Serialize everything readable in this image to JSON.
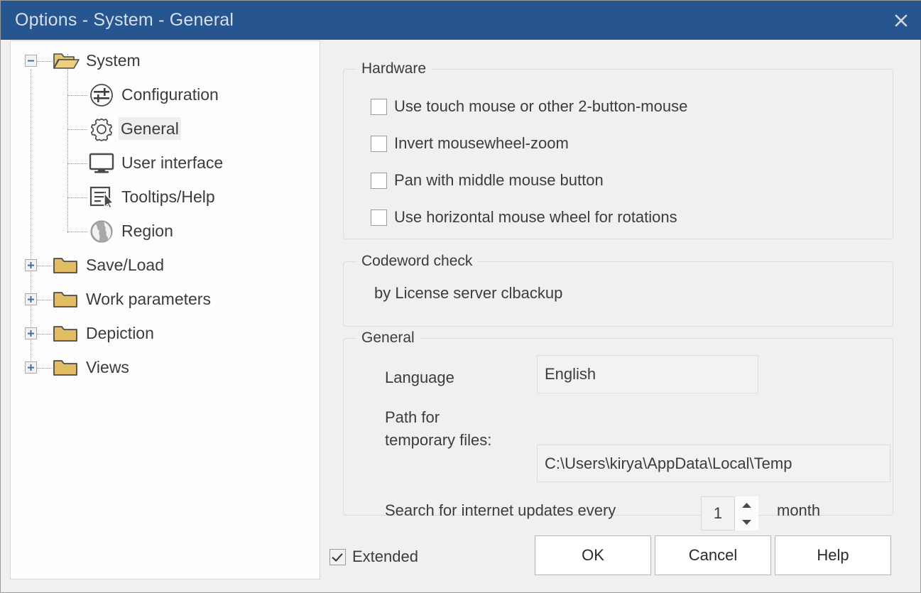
{
  "window": {
    "title": "Options - System - General",
    "close_icon": "close-icon"
  },
  "tree": {
    "nodes": [
      {
        "label": "System",
        "icon": "open-folder-icon",
        "expander": "minus",
        "level": 0,
        "selected": false
      },
      {
        "label": "Configuration",
        "icon": "sliders-circle-icon",
        "expander": "none",
        "level": 1,
        "selected": false
      },
      {
        "label": "General",
        "icon": "gear-icon",
        "expander": "none",
        "level": 1,
        "selected": true
      },
      {
        "label": "User interface",
        "icon": "monitor-icon",
        "expander": "none",
        "level": 1,
        "selected": false
      },
      {
        "label": "Tooltips/Help",
        "icon": "tooltip-cursor-icon",
        "expander": "none",
        "level": 1,
        "selected": false
      },
      {
        "label": "Region",
        "icon": "globe-icon",
        "expander": "none",
        "level": 1,
        "selected": false
      },
      {
        "label": "Save/Load",
        "icon": "folder-icon",
        "expander": "plus",
        "level": 0,
        "selected": false
      },
      {
        "label": "Work parameters",
        "icon": "folder-icon",
        "expander": "plus",
        "level": 0,
        "selected": false
      },
      {
        "label": "Depiction",
        "icon": "folder-icon",
        "expander": "plus",
        "level": 0,
        "selected": false
      },
      {
        "label": "Views",
        "icon": "folder-icon",
        "expander": "plus",
        "level": 0,
        "selected": false
      }
    ]
  },
  "hardware": {
    "title": "Hardware",
    "checkboxes": [
      {
        "label": "Use touch mouse or other 2-button-mouse",
        "checked": false
      },
      {
        "label": "Invert mousewheel-zoom",
        "checked": false
      },
      {
        "label": "Pan with middle mouse button",
        "checked": false
      },
      {
        "label": "Use horizontal mouse wheel for rotations",
        "checked": false
      }
    ]
  },
  "codeword": {
    "title": "Codeword check",
    "status": "by License server clbackup"
  },
  "general": {
    "title": "General",
    "language_label": "Language",
    "language_value": "English",
    "path_label_line1": "Path for",
    "path_label_line2": " temporary files:",
    "path_value": "C:\\Users\\kirya\\AppData\\Local\\Temp",
    "updates_label": "Search for internet updates every",
    "updates_value": "1",
    "updates_unit": "month"
  },
  "footer": {
    "extended_label": "Extended",
    "extended_checked": true,
    "ok_label": "OK",
    "cancel_label": "Cancel",
    "help_label": "Help"
  },
  "colors": {
    "titlebar": "#27558f",
    "dialog_bg": "#f0f0f0",
    "panel_bg": "#fdfdfd",
    "folder": "#e2bd63",
    "text": "#3c3c3c"
  }
}
